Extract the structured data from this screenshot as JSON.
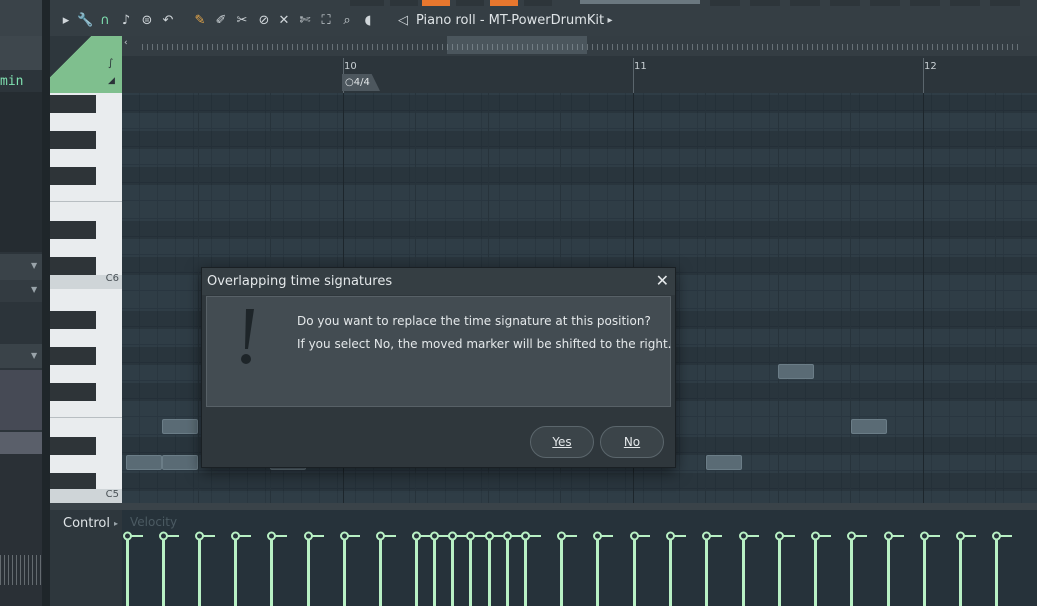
{
  "left_panel": {
    "partial_text": "min"
  },
  "toolbar": {
    "title": "Piano roll - MT-PowerDrumKit",
    "icons": [
      "play-arrow-icon",
      "wrench-icon",
      "magnet-icon",
      "note-icon",
      "stamp-icon",
      "undo-icon",
      "pencil-icon",
      "paint-icon",
      "delete-icon",
      "mute-icon",
      "slice-icon",
      "select-icon",
      "zoom-icon",
      "playback-icon",
      "speaker-icon",
      "more-arrow-icon"
    ]
  },
  "ruler": {
    "bars": [
      "10",
      "11",
      "12"
    ],
    "time_signature": "4/4"
  },
  "keys": {
    "labels": [
      "C6",
      "C5"
    ]
  },
  "control": {
    "label": "Control",
    "parameter": "Velocity",
    "velocity_values": [
      1,
      1,
      1,
      1,
      1,
      1,
      1,
      1,
      1,
      1,
      1,
      1,
      1,
      1,
      1,
      1,
      1,
      1,
      1,
      1,
      1,
      1,
      1,
      1,
      1,
      1,
      1,
      1,
      1,
      1,
      1,
      1,
      1
    ]
  },
  "dialog": {
    "title": "Overlapping time signatures",
    "line1": "Do you want to replace the time signature at this position?",
    "line2": "If you select No, the moved marker will be shifted to the right.",
    "yes_label": "Yes",
    "no_label": "No",
    "close_glyph": "✕"
  },
  "colors": {
    "accent_green": "#7fbf8e",
    "velocity": "#b8f0c4",
    "toolbar_orange": "#e8772e"
  }
}
